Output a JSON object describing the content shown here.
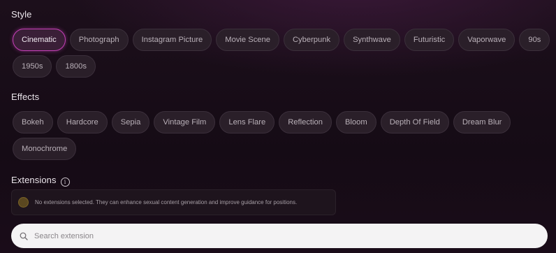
{
  "style": {
    "title": "Style",
    "options": [
      {
        "label": "Cinematic",
        "selected": true
      },
      {
        "label": "Photograph",
        "selected": false
      },
      {
        "label": "Instagram Picture",
        "selected": false
      },
      {
        "label": "Movie Scene",
        "selected": false
      },
      {
        "label": "Cyberpunk",
        "selected": false
      },
      {
        "label": "Synthwave",
        "selected": false
      },
      {
        "label": "Futuristic",
        "selected": false
      },
      {
        "label": "Vaporwave",
        "selected": false
      },
      {
        "label": "90s",
        "selected": false
      },
      {
        "label": "1950s",
        "selected": false
      },
      {
        "label": "1800s",
        "selected": false
      }
    ]
  },
  "effects": {
    "title": "Effects",
    "options": [
      {
        "label": "Bokeh"
      },
      {
        "label": "Hardcore"
      },
      {
        "label": "Sepia"
      },
      {
        "label": "Vintage Film"
      },
      {
        "label": "Lens Flare"
      },
      {
        "label": "Reflection"
      },
      {
        "label": "Bloom"
      },
      {
        "label": "Depth Of Field"
      },
      {
        "label": "Dream Blur"
      },
      {
        "label": "Monochrome"
      }
    ]
  },
  "extensions": {
    "title": "Extensions",
    "info_icon": "info-icon",
    "info_glyph": "i",
    "empty_message": "No extensions selected. They can enhance sexual content generation and improve guidance for positions."
  },
  "search": {
    "placeholder": "Search extension",
    "icon": "search-icon"
  },
  "colors": {
    "accent": "#c43fb6",
    "background": "#1a0e19",
    "chip_background": "#2a1f29"
  }
}
